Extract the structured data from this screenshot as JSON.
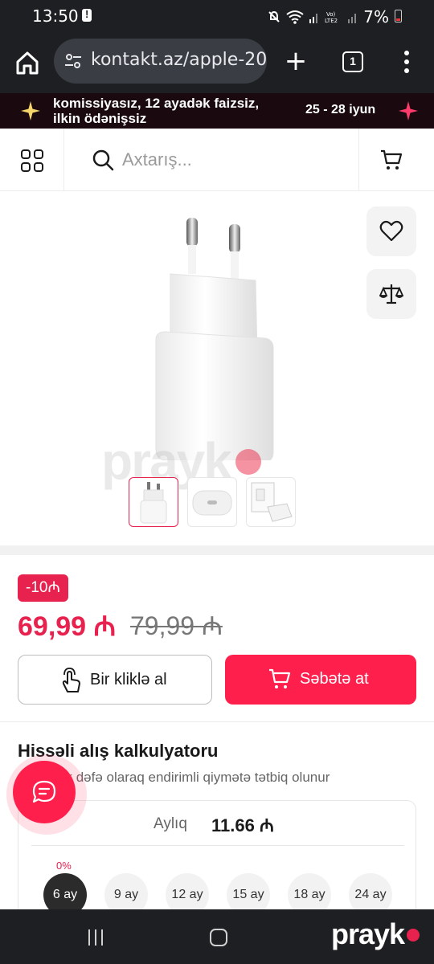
{
  "status_bar": {
    "time": "13:50",
    "battery": "7%"
  },
  "browser": {
    "url": "kontakt.az/apple-20",
    "tab_count": "1"
  },
  "promo": {
    "line1": "komissiyasız, 12 ayadək faizsiz,",
    "line2": "ilkin ödənişsiz",
    "dates": "25 - 28 iyun"
  },
  "header": {
    "search_placeholder": "Axtarış..."
  },
  "gallery": {
    "watermark": "prayk",
    "thumbnails": [
      "charger-front",
      "charger-port",
      "charger-box"
    ]
  },
  "product": {
    "discount_badge": "-10₼",
    "price_current": "69,99 ₼",
    "price_old": "79,99 ₼",
    "one_click_label": "Bir kliklə al",
    "add_to_cart_label": "Səbətə at"
  },
  "calculator": {
    "title": "Hissəli alış kalkulyatoru",
    "note": "Sifariş ilk dəfə olaraq endirimli qiymətə tətbiq olunur",
    "monthly_label": "Aylıq",
    "monthly_value": "11.66 ₼",
    "rate": "0%",
    "terms": [
      "6 ay",
      "9 ay",
      "12 ay",
      "15 ay",
      "18 ay",
      "24 ay"
    ],
    "selected_term": "6 ay"
  },
  "nav": {
    "logo": "prayk"
  },
  "colors": {
    "accent": "#ff1f4c",
    "dark": "#1e1f22"
  }
}
